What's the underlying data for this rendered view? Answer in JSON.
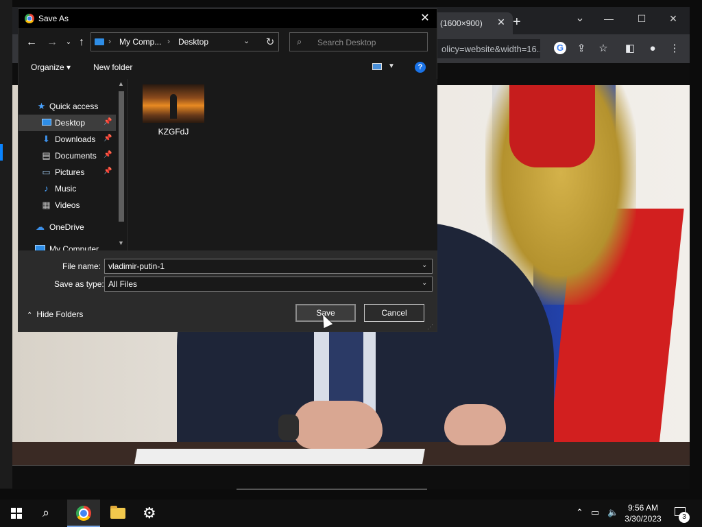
{
  "browser": {
    "tab_title": "g (1600×900)",
    "tab_close": "✕",
    "new_tab": "+",
    "omnibox_text": "olicy=website&width=16...",
    "window_controls": {
      "minimize": "—",
      "maximize": "☐",
      "close": "✕",
      "dropdown": "⌄"
    },
    "toolbar_icons": [
      "google-lens-icon",
      "share-icon",
      "star-icon",
      "sidepanel-icon",
      "profile-icon",
      "menu-icon"
    ]
  },
  "dialog": {
    "title": "Save As",
    "close": "✕",
    "address_parts": [
      "My Comp...",
      "Desktop"
    ],
    "search_placeholder": "Search Desktop",
    "organize_label": "Organize ▾",
    "new_folder_label": "New folder",
    "help_label": "?",
    "nav_items": [
      {
        "label": "Quick access",
        "icon": "star-icon"
      },
      {
        "label": "Desktop",
        "icon": "desktop-icon",
        "pinned": true,
        "selected": true
      },
      {
        "label": "Downloads",
        "icon": "download-icon",
        "pinned": true
      },
      {
        "label": "Documents",
        "icon": "document-icon",
        "pinned": true
      },
      {
        "label": "Pictures",
        "icon": "pictures-icon",
        "pinned": true
      },
      {
        "label": "Music",
        "icon": "music-icon"
      },
      {
        "label": "Videos",
        "icon": "videos-icon"
      },
      {
        "label": "OneDrive",
        "icon": "cloud-icon"
      },
      {
        "label": "My Computer",
        "icon": "computer-icon"
      }
    ],
    "files": [
      {
        "name": "KZGFdJ"
      }
    ],
    "file_name_label": "File name:",
    "file_name_value": "vladimir-putin-1",
    "save_type_label": "Save as type:",
    "save_type_value": "All Files",
    "hide_folders_label": "Hide Folders",
    "save_label": "Save",
    "cancel_label": "Cancel"
  },
  "taskbar": {
    "time": "9:56 AM",
    "date": "3/30/2023",
    "notification_count": "3"
  },
  "colors": {
    "accent_blue": "#0a84ff",
    "dialog_bg": "#191919",
    "form_bg": "#2b2b2b",
    "chrome_tab": "#35363a"
  }
}
